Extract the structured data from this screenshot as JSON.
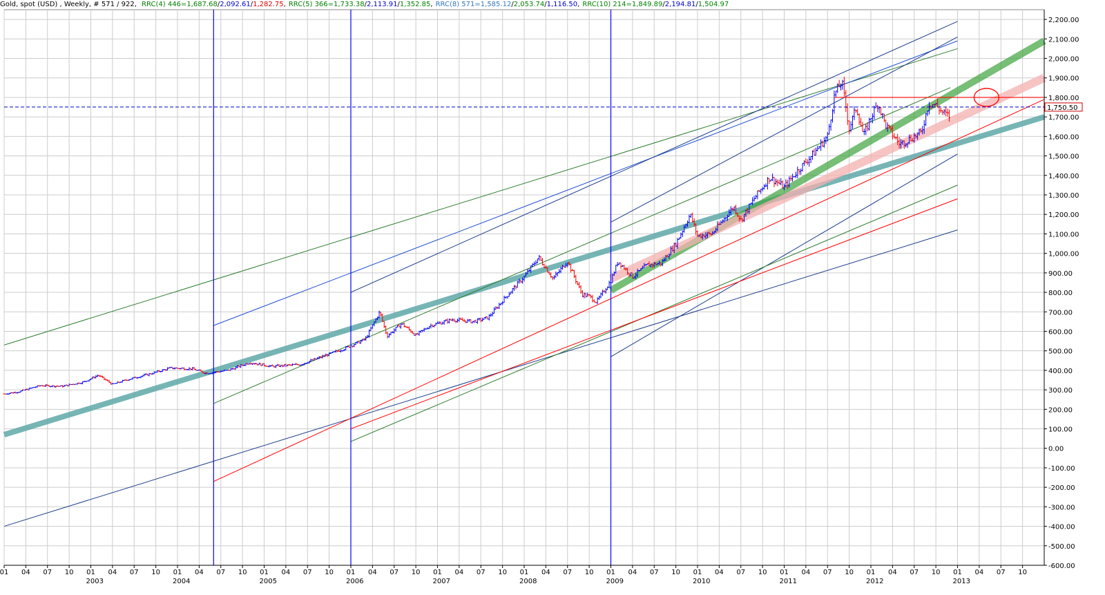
{
  "header": {
    "title": "Gold, spot (USD) , Weekly, # 571 / 922,",
    "indicators": [
      {
        "label": "RRC(4) 446=",
        "label_color": "#008000",
        "v1": "1,687.68",
        "c1": "#008000",
        "v2": "2,092.61",
        "c2": "#0000cc",
        "v3": "1,282.75",
        "c3": "#e00000"
      },
      {
        "label": "RRC(5) 366=",
        "label_color": "#008000",
        "v1": "1,733.38",
        "c1": "#008000",
        "v2": "2,113.91",
        "c2": "#0000cc",
        "v3": "1,352.85",
        "c3": "#008000"
      },
      {
        "label": "RRC(8) 571=",
        "label_color": "#3377bb",
        "v1": "1,585.12",
        "c1": "#3377bb",
        "v2": "2,053.74",
        "c2": "#008000",
        "v3": "1,116.50",
        "c3": "#0000cc"
      },
      {
        "label": "RRC(10) 214=",
        "label_color": "#008000",
        "v1": "1,849.89",
        "c1": "#008000",
        "v2": "2,194.81",
        "c2": "#0000cc",
        "v3": "1,504.97",
        "c3": "#008000"
      }
    ]
  },
  "colors": {
    "bull": "#0000ee",
    "bear": "#ee0000",
    "grid": "#cccccc",
    "teal_band": "#5fa8a8",
    "green_band": "#3da33d",
    "pink_band": "#f4b0b0",
    "marker": "#0000ff",
    "dark_green": "#2e7d2e",
    "navy": "#1a3c8c",
    "red": "#ff0000",
    "blue": "#1f4fd1"
  },
  "chart_data": {
    "type": "ohlc",
    "title": "Gold, spot (USD) , Weekly",
    "ylim": [
      -600,
      2250
    ],
    "y_ticks": [
      2200,
      2100,
      2000,
      1900,
      1800,
      1700,
      1600,
      1500,
      1400,
      1300,
      1200,
      1100,
      1000,
      900,
      800,
      700,
      600,
      500,
      400,
      300,
      200,
      100,
      0,
      -100,
      -200,
      -300,
      -400,
      -500,
      -600
    ],
    "y_tick_labels": [
      "2,200.00",
      "2,100.00",
      "2,000.00",
      "1,900.00",
      "1,800.00",
      "1,700.00",
      "1,600.00",
      "1,500.00",
      "1,400.00",
      "1,300.00",
      "1,200.00",
      "1,100.00",
      "1,000.00",
      "900.00",
      "800.00",
      "700.00",
      "600.00",
      "500.00",
      "400.00",
      "300.00",
      "200.00",
      "100.00",
      "0.00",
      "-100.00",
      "-200.00",
      "-300.00",
      "-400.00",
      "-500.00",
      "-600.00"
    ],
    "xlim": [
      "2002-01",
      "2014-01"
    ],
    "month_ticks": [
      "2002-01",
      "2002-04",
      "2002-07",
      "2002-10",
      "2003-01",
      "2003-04",
      "2003-07",
      "2003-10",
      "2004-01",
      "2004-04",
      "2004-07",
      "2004-10",
      "2005-01",
      "2005-04",
      "2005-07",
      "2005-10",
      "2006-01",
      "2006-04",
      "2006-07",
      "2006-10",
      "2007-01",
      "2007-04",
      "2007-07",
      "2007-10",
      "2008-01",
      "2008-04",
      "2008-07",
      "2008-10",
      "2009-01",
      "2009-04",
      "2009-07",
      "2009-10",
      "2010-01",
      "2010-04",
      "2010-07",
      "2010-10",
      "2011-01",
      "2011-04",
      "2011-07",
      "2011-10",
      "2012-01",
      "2012-04",
      "2012-07",
      "2012-10",
      "2013-01",
      "2013-04",
      "2013-07",
      "2013-10"
    ],
    "month_tick_labels": [
      "01",
      "04",
      "07",
      "10",
      "01",
      "04",
      "07",
      "10",
      "01",
      "04",
      "07",
      "10",
      "01",
      "04",
      "07",
      "10",
      "01",
      "04",
      "07",
      "10",
      "01",
      "04",
      "07",
      "10",
      "01",
      "04",
      "07",
      "10",
      "01",
      "04",
      "07",
      "10",
      "01",
      "04",
      "07",
      "10",
      "01",
      "04",
      "07",
      "10",
      "01",
      "04",
      "07",
      "10",
      "01",
      "04",
      "07",
      "10"
    ],
    "year_labels": [
      {
        "date": "2003-01",
        "label": "2003"
      },
      {
        "date": "2004-01",
        "label": "2004"
      },
      {
        "date": "2005-01",
        "label": "2005"
      },
      {
        "date": "2006-01",
        "label": "2006"
      },
      {
        "date": "2007-01",
        "label": "2007"
      },
      {
        "date": "2008-01",
        "label": "2008"
      },
      {
        "date": "2009-01",
        "label": "2009"
      },
      {
        "date": "2010-01",
        "label": "2010"
      },
      {
        "date": "2011-01",
        "label": "2011"
      },
      {
        "date": "2012-01",
        "label": "2012"
      },
      {
        "date": "2013-01",
        "label": "2013"
      }
    ],
    "price_path": [
      [
        "2002-01",
        279
      ],
      [
        "2002-03",
        290
      ],
      [
        "2002-06",
        322
      ],
      [
        "2002-09",
        318
      ],
      [
        "2002-12",
        340
      ],
      [
        "2003-02",
        375
      ],
      [
        "2003-04",
        328
      ],
      [
        "2003-06",
        352
      ],
      [
        "2003-09",
        380
      ],
      [
        "2003-12",
        412
      ],
      [
        "2004-03",
        408
      ],
      [
        "2004-05",
        385
      ],
      [
        "2004-08",
        400
      ],
      [
        "2004-11",
        440
      ],
      [
        "2005-02",
        420
      ],
      [
        "2005-06",
        430
      ],
      [
        "2005-09",
        470
      ],
      [
        "2005-12",
        510
      ],
      [
        "2006-03",
        560
      ],
      [
        "2006-05",
        700
      ],
      [
        "2006-06",
        575
      ],
      [
        "2006-08",
        640
      ],
      [
        "2006-10",
        580
      ],
      [
        "2006-12",
        630
      ],
      [
        "2007-03",
        660
      ],
      [
        "2007-06",
        650
      ],
      [
        "2007-08",
        670
      ],
      [
        "2007-11",
        800
      ],
      [
        "2008-01",
        880
      ],
      [
        "2008-03",
        980
      ],
      [
        "2008-05",
        870
      ],
      [
        "2008-07",
        960
      ],
      [
        "2008-09",
        790
      ],
      [
        "2008-10",
        780
      ],
      [
        "2008-11",
        750
      ],
      [
        "2009-01",
        860
      ],
      [
        "2009-02",
        960
      ],
      [
        "2009-04",
        880
      ],
      [
        "2009-06",
        940
      ],
      [
        "2009-08",
        950
      ],
      [
        "2009-10",
        1050
      ],
      [
        "2009-12",
        1200
      ],
      [
        "2010-01",
        1090
      ],
      [
        "2010-03",
        1100
      ],
      [
        "2010-06",
        1240
      ],
      [
        "2010-07",
        1170
      ],
      [
        "2010-09",
        1290
      ],
      [
        "2010-11",
        1390
      ],
      [
        "2011-01",
        1340
      ],
      [
        "2011-03",
        1430
      ],
      [
        "2011-05",
        1510
      ],
      [
        "2011-07",
        1600
      ],
      [
        "2011-08",
        1820
      ],
      [
        "2011-09",
        1880
      ],
      [
        "2011-10",
        1640
      ],
      [
        "2011-11",
        1750
      ],
      [
        "2011-12",
        1600
      ],
      [
        "2012-01",
        1700
      ],
      [
        "2012-02",
        1770
      ],
      [
        "2012-03",
        1660
      ],
      [
        "2012-05",
        1560
      ],
      [
        "2012-07",
        1600
      ],
      [
        "2012-08",
        1620
      ],
      [
        "2012-09",
        1770
      ],
      [
        "2012-10",
        1760
      ],
      [
        "2012-11",
        1720
      ],
      [
        "2012-12",
        1700
      ]
    ],
    "current_price": 1750.5,
    "current_price_label": "1,750.50",
    "vertical_markers": [
      "2004-06",
      "2006-01",
      "2009-01"
    ],
    "resistance_line": {
      "start": "2011-08",
      "end": "2014-01",
      "value": 1800
    },
    "target_circle": {
      "date": "2013-05",
      "value": 1800
    },
    "band_lines": [
      {
        "name": "teal-band",
        "color": "teal_band",
        "width": 8,
        "opacity": 0.85,
        "p1": [
          "2002-01",
          70
        ],
        "p2": [
          "2014-01",
          1700
        ]
      },
      {
        "name": "green-band",
        "color": "green_band",
        "width": 10,
        "opacity": 0.7,
        "p1": [
          "2009-01",
          810
        ],
        "p2": [
          "2014-01",
          2090
        ]
      },
      {
        "name": "pink-band",
        "color": "pink_band",
        "width": 12,
        "opacity": 0.75,
        "p1": [
          "2009-01",
          870
        ],
        "p2": [
          "2014-01",
          1900
        ]
      },
      {
        "name": "thin-green-1",
        "color": "dark_green",
        "width": 1,
        "opacity": 1,
        "p1": [
          "2002-01",
          530
        ],
        "p2": [
          "2013-01",
          2050
        ]
      },
      {
        "name": "thin-blue-1",
        "color": "blue",
        "width": 1,
        "opacity": 1,
        "p1": [
          "2004-06",
          630
        ],
        "p2": [
          "2013-01",
          2090
        ]
      },
      {
        "name": "thin-navy-1",
        "color": "navy",
        "width": 1,
        "opacity": 1,
        "p1": [
          "2006-01",
          800
        ],
        "p2": [
          "2013-01",
          2190
        ]
      },
      {
        "name": "thin-navy-2",
        "color": "navy",
        "width": 1,
        "opacity": 1,
        "p1": [
          "2009-01",
          1160
        ],
        "p2": [
          "2013-01",
          2110
        ]
      },
      {
        "name": "thin-navy-3",
        "color": "navy",
        "width": 1,
        "opacity": 1,
        "p1": [
          "2002-01",
          -400
        ],
        "p2": [
          "2013-01",
          1120
        ]
      },
      {
        "name": "thin-navy-4",
        "color": "navy",
        "width": 1,
        "opacity": 1,
        "p1": [
          "2009-01",
          470
        ],
        "p2": [
          "2013-01",
          1510
        ]
      },
      {
        "name": "thin-green-2",
        "color": "dark_green",
        "width": 1,
        "opacity": 1,
        "p1": [
          "2004-06",
          230
        ],
        "p2": [
          "2012-12",
          1850
        ]
      },
      {
        "name": "thin-green-3",
        "color": "dark_green",
        "width": 1,
        "opacity": 1,
        "p1": [
          "2006-01",
          35
        ],
        "p2": [
          "2013-01",
          1350
        ]
      },
      {
        "name": "thin-red-1",
        "color": "red",
        "width": 1,
        "opacity": 1,
        "p1": [
          "2004-06",
          -170
        ],
        "p2": [
          "2014-01",
          1790
        ]
      },
      {
        "name": "thin-red-2",
        "color": "red",
        "width": 1,
        "opacity": 1,
        "p1": [
          "2006-01",
          100
        ],
        "p2": [
          "2013-01",
          1280
        ]
      }
    ]
  }
}
